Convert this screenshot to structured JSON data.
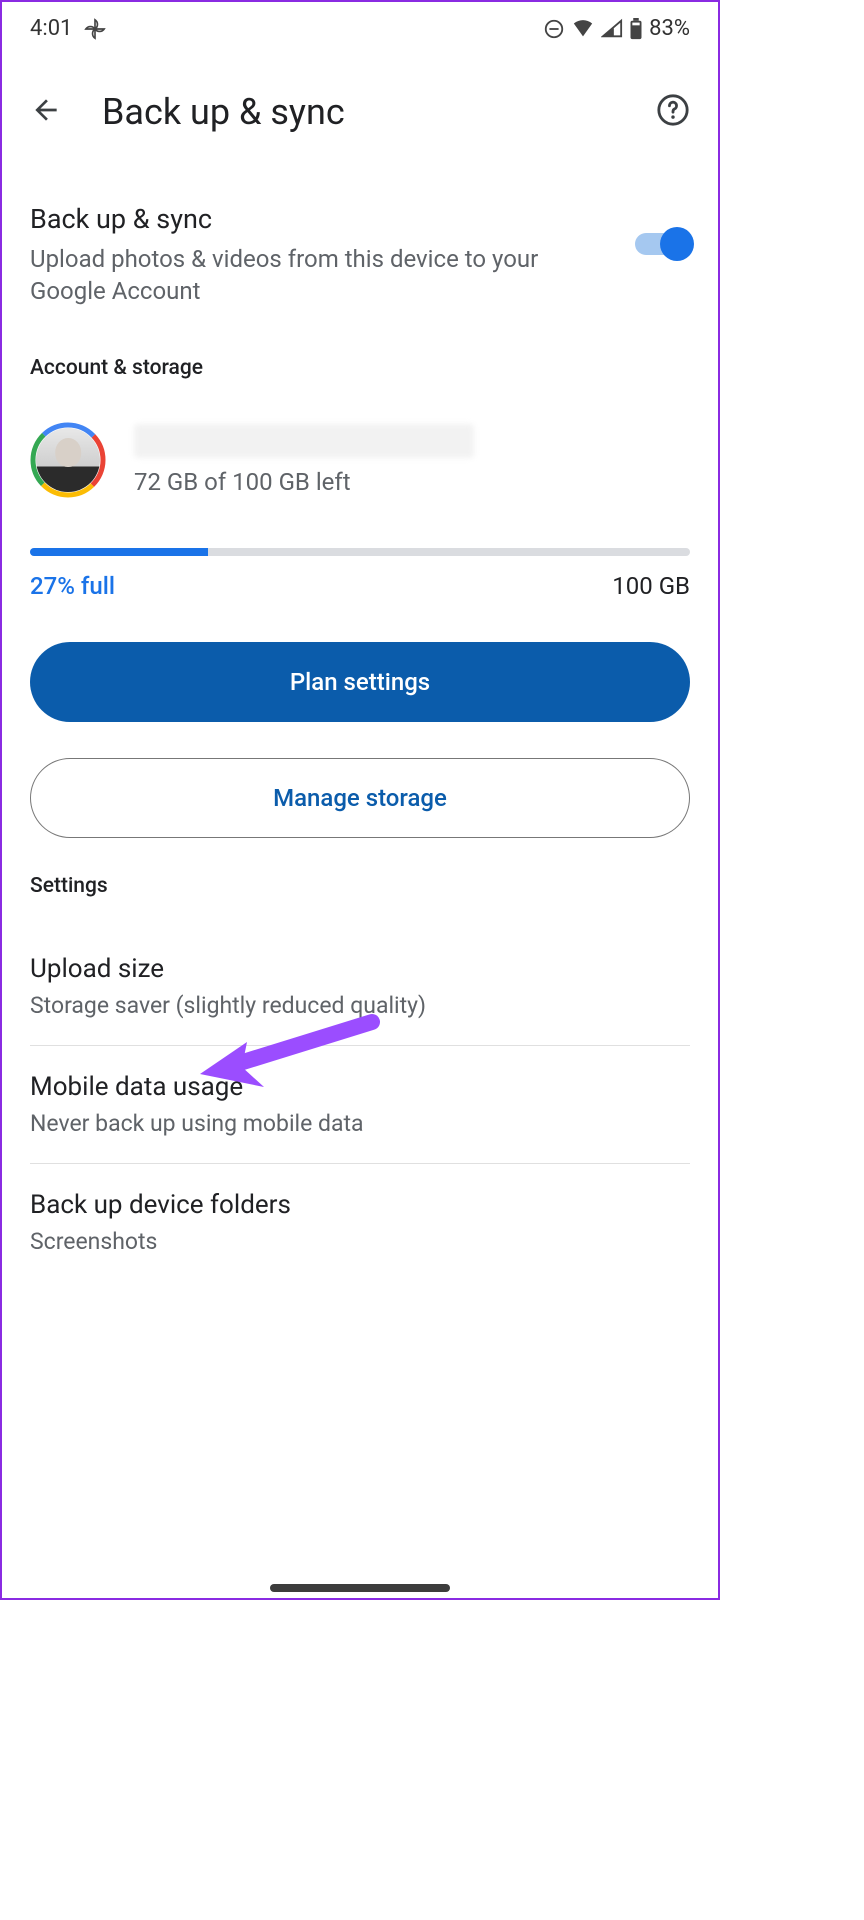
{
  "status": {
    "time": "4:01",
    "battery": "83%"
  },
  "header": {
    "title": "Back up & sync"
  },
  "toggle": {
    "title": "Back up & sync",
    "subtitle": "Upload photos & videos from this device to your Google Account",
    "enabled": true
  },
  "account_section": {
    "header": "Account & storage",
    "storage_left": "72 GB of 100 GB left"
  },
  "progress": {
    "percent": 27,
    "percent_label": "27% full",
    "total_label": "100 GB"
  },
  "buttons": {
    "plan": "Plan settings",
    "manage": "Manage storage"
  },
  "settings_header": "Settings",
  "settings": [
    {
      "title": "Upload size",
      "sub": "Storage saver (slightly reduced quality)"
    },
    {
      "title": "Mobile data usage",
      "sub": "Never back up using mobile data"
    },
    {
      "title": "Back up device folders",
      "sub": "Screenshots"
    }
  ],
  "annotation": {
    "color": "#9b4dff"
  }
}
